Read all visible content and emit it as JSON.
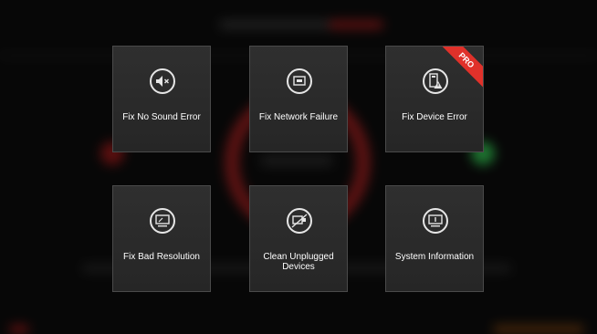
{
  "tiles": [
    {
      "label": "Fix No Sound Error",
      "icon": "speaker-mute-icon"
    },
    {
      "label": "Fix Network Failure",
      "icon": "network-icon"
    },
    {
      "label": "Fix Device Error",
      "icon": "device-warning-icon",
      "badge": "PRO"
    },
    {
      "label": "Fix Bad Resolution",
      "icon": "monitor-resolution-icon"
    },
    {
      "label_line1": "Clean Unplugged",
      "label_line2": "Devices",
      "icon": "unplugged-device-icon"
    },
    {
      "label": "System Information",
      "icon": "system-info-icon"
    }
  ],
  "colors": {
    "tile_bg": "#2b2b2b",
    "tile_border": "#4a4a4a",
    "badge": "#e0312a",
    "background_accent": "#8c1d1d",
    "background_green": "#2fb04a"
  }
}
